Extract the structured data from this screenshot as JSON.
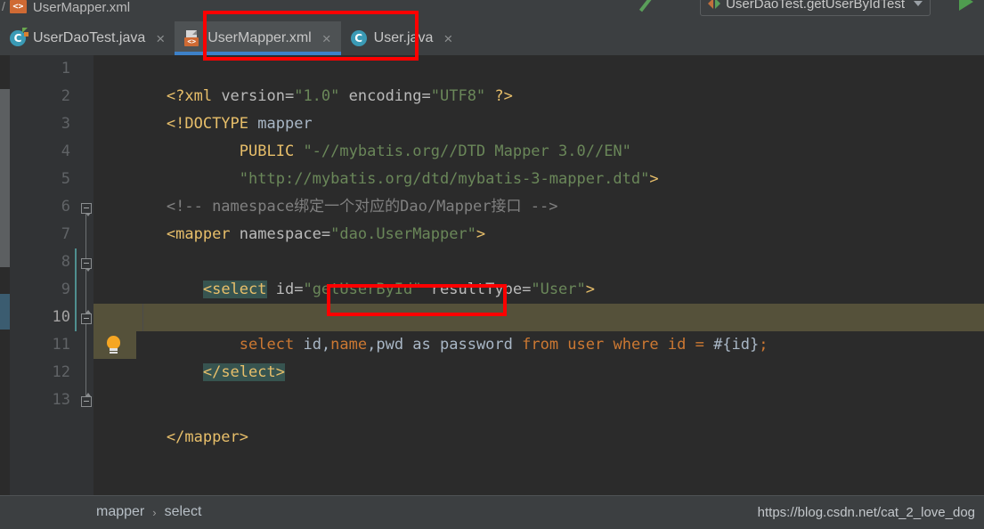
{
  "window": {
    "top_breadcrumb": {
      "separator": "/",
      "file_icon": "xml-file-icon",
      "file_label": "UserMapper.xml"
    },
    "toolbar": {
      "wrench_icon": "wrench-icon",
      "run_config_name": "UserDaoTest.getUserByIdTest",
      "run_config_icon": "run-configuration-icon",
      "dropdown_icon": "chevron-down-icon",
      "run_icon": "run-play-icon"
    }
  },
  "tabs": [
    {
      "label": "UserDaoTest.java",
      "icon": "java-class-icon",
      "icon_glyph": "C",
      "close": "×",
      "active": false
    },
    {
      "label": "UserMapper.xml",
      "icon": "xml-file-icon",
      "icon_glyph": "<>",
      "close": "×",
      "active": true
    },
    {
      "label": "User.java",
      "icon": "java-class-icon",
      "icon_glyph": "C",
      "close": "×",
      "active": false
    }
  ],
  "editor": {
    "line_numbers": [
      "1",
      "2",
      "3",
      "4",
      "5",
      "6",
      "7",
      "8",
      "9",
      "10",
      "11",
      "12",
      "13"
    ],
    "current_line": "10",
    "bulb_icon": "intention-bulb-icon",
    "lines": [
      {
        "n": "1",
        "text": "<?xml version=\"1.0\" encoding=\"UTF8\" ?>"
      },
      {
        "n": "2",
        "text": "<!DOCTYPE mapper"
      },
      {
        "n": "3",
        "text": "        PUBLIC \"-//mybatis.org//DTD Mapper 3.0//EN\""
      },
      {
        "n": "4",
        "text": "        \"http://mybatis.org/dtd/mybatis-3-mapper.dtd\">"
      },
      {
        "n": "5",
        "text": "<!-- namespace绑定一个对应的Dao/Mapper接口 -->"
      },
      {
        "n": "6",
        "text": "<mapper namespace=\"dao.UserMapper\">"
      },
      {
        "n": "7",
        "text": ""
      },
      {
        "n": "8",
        "text": "    <select id=\"getUserById\" resultType=\"User\">"
      },
      {
        "n": "9",
        "text": "        select id,name,pwd as password from user where id = #{id};"
      },
      {
        "n": "10",
        "text": "    </select>"
      },
      {
        "n": "11",
        "text": ""
      },
      {
        "n": "12",
        "text": ""
      },
      {
        "n": "13",
        "text": "</mapper>"
      }
    ],
    "tokens": {
      "l1": {
        "open": "<?xml",
        "attr1": " version=",
        "v1": "\"1.0\"",
        "attr2": " encoding=",
        "v2": "\"UTF8\"",
        "close": " ?>"
      },
      "l2": {
        "doctype": "<!DOCTYPE",
        "name": " mapper"
      },
      "l3": {
        "indent": "        ",
        "kw": "PUBLIC",
        "str": " \"-//mybatis.org//DTD Mapper 3.0//EN\""
      },
      "l4": {
        "indent": "        ",
        "str": "\"http://mybatis.org/dtd/mybatis-3-mapper.dtd\"",
        "gt": ">"
      },
      "l5": {
        "comment": "<!-- namespace绑定一个对应的Dao/Mapper接口 -->"
      },
      "l6": {
        "tag_open": "<mapper",
        "attr": " namespace=",
        "val": "\"dao.UserMapper\"",
        "gt": ">"
      },
      "l8": {
        "indent": "    ",
        "tag_open": "<select",
        "attr1": " id=",
        "val1": "\"getUserById\"",
        "attr2": " resultType=",
        "val2": "\"User\"",
        "gt": ">"
      },
      "l9": {
        "indent": "        ",
        "kw1": "select",
        "sp": " ",
        "f1": "id,",
        "f2": "name",
        "f3": ",pwd as password",
        "rest": " from user where id = ",
        "param": "#{id}",
        "semi": ";"
      },
      "l10": {
        "indent": "    ",
        "tag_close": "</select>"
      },
      "l13": {
        "tag_close": "</mapper>"
      }
    }
  },
  "status": {
    "breadcrumb": [
      {
        "label": "mapper"
      },
      {
        "label": "select"
      }
    ],
    "breadcrumb_separator": "›",
    "watermark": "https://blog.csdn.net/cat_2_love_dog"
  },
  "annotations": [
    {
      "name": "tab-highlight-box",
      "target": "UserMapper.xml tab"
    },
    {
      "name": "code-highlight-box",
      "target": ",pwd as password"
    }
  ],
  "colors": {
    "background": "#2b2b2b",
    "gutter": "#313335",
    "panel": "#3c3f41",
    "tab_active": "#4e5254",
    "tab_underline": "#3d81c8",
    "annotation": "#ff0000",
    "highlight_yellow": "#55513a",
    "highlight_tag": "#375450",
    "tag": "#e8bf6a",
    "string": "#6a8759",
    "comment": "#808080",
    "text": "#a9b7c6",
    "sql_keyword": "#cc7832"
  }
}
